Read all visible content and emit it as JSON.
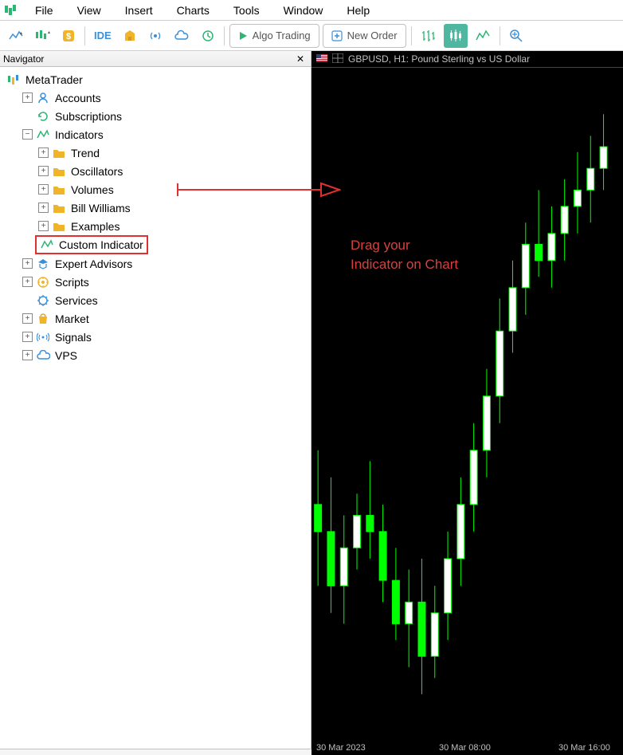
{
  "menu": {
    "items": [
      "File",
      "View",
      "Insert",
      "Charts",
      "Tools",
      "Window",
      "Help"
    ]
  },
  "toolbar": {
    "algo_label": "Algo Trading",
    "neworder_label": "New Order",
    "ide_label": "IDE"
  },
  "navigator": {
    "title": "Navigator",
    "root": "MetaTrader",
    "items": {
      "accounts": "Accounts",
      "subscriptions": "Subscriptions",
      "indicators": "Indicators",
      "trend": "Trend",
      "oscillators": "Oscillators",
      "volumes": "Volumes",
      "billwilliams": "Bill Williams",
      "examples": "Examples",
      "custom": "Custom Indicator",
      "experts": "Expert Advisors",
      "scripts": "Scripts",
      "services": "Services",
      "market": "Market",
      "signals": "Signals",
      "vps": "VPS"
    }
  },
  "chart": {
    "title": "GBPUSD, H1:  Pound Sterling vs US Dollar",
    "axis": {
      "l1": "30 Mar 2023",
      "l2": "30 Mar 08:00",
      "l3": "30 Mar 16:00"
    }
  },
  "annotation": {
    "line1": "Drag your",
    "line2": "Indicator on Chart"
  },
  "chart_data": {
    "type": "candlestick",
    "symbol": "GBPUSD",
    "timeframe": "H1",
    "candles": [
      {
        "o": 40,
        "h": 50,
        "l": 25,
        "c": 35
      },
      {
        "o": 35,
        "h": 45,
        "l": 20,
        "c": 25
      },
      {
        "o": 25,
        "h": 38,
        "l": 18,
        "c": 32
      },
      {
        "o": 32,
        "h": 42,
        "l": 28,
        "c": 38
      },
      {
        "o": 38,
        "h": 48,
        "l": 30,
        "c": 35
      },
      {
        "o": 35,
        "h": 40,
        "l": 22,
        "c": 26
      },
      {
        "o": 26,
        "h": 32,
        "l": 15,
        "c": 18
      },
      {
        "o": 18,
        "h": 28,
        "l": 10,
        "c": 22
      },
      {
        "o": 22,
        "h": 30,
        "l": 5,
        "c": 12
      },
      {
        "o": 12,
        "h": 25,
        "l": 8,
        "c": 20
      },
      {
        "o": 20,
        "h": 35,
        "l": 15,
        "c": 30
      },
      {
        "o": 30,
        "h": 45,
        "l": 25,
        "c": 40
      },
      {
        "o": 40,
        "h": 55,
        "l": 35,
        "c": 50
      },
      {
        "o": 50,
        "h": 65,
        "l": 45,
        "c": 60
      },
      {
        "o": 60,
        "h": 78,
        "l": 55,
        "c": 72
      },
      {
        "o": 72,
        "h": 85,
        "l": 68,
        "c": 80
      },
      {
        "o": 80,
        "h": 92,
        "l": 75,
        "c": 88
      },
      {
        "o": 88,
        "h": 98,
        "l": 82,
        "c": 85
      },
      {
        "o": 85,
        "h": 95,
        "l": 80,
        "c": 90
      },
      {
        "o": 90,
        "h": 100,
        "l": 85,
        "c": 95
      },
      {
        "o": 95,
        "h": 105,
        "l": 90,
        "c": 98
      },
      {
        "o": 98,
        "h": 108,
        "l": 92,
        "c": 102
      },
      {
        "o": 102,
        "h": 112,
        "l": 98,
        "c": 106
      }
    ]
  }
}
